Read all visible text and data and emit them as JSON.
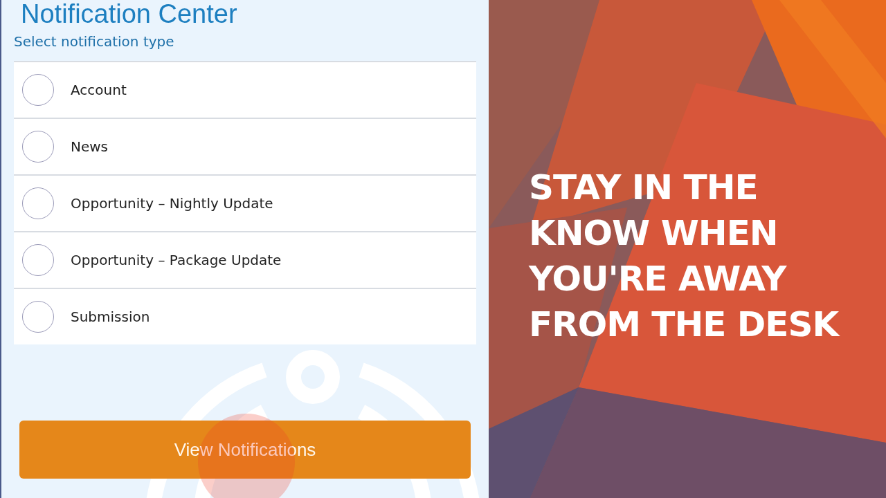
{
  "screen": {
    "title": "Notification Center",
    "subtitle": "Select notification type"
  },
  "options": [
    {
      "label": "Account",
      "selected": false
    },
    {
      "label": "News",
      "selected": false
    },
    {
      "label": "Opportunity – Nightly Update",
      "selected": false
    },
    {
      "label": "Opportunity – Package Update",
      "selected": false
    },
    {
      "label": "Submission",
      "selected": false
    }
  ],
  "button": {
    "label": "View Notifications"
  },
  "promo": {
    "headline_lines": [
      "STAY IN THE",
      "KNOW WHEN",
      "YOU'RE AWAY",
      "FROM THE DESK"
    ]
  }
}
